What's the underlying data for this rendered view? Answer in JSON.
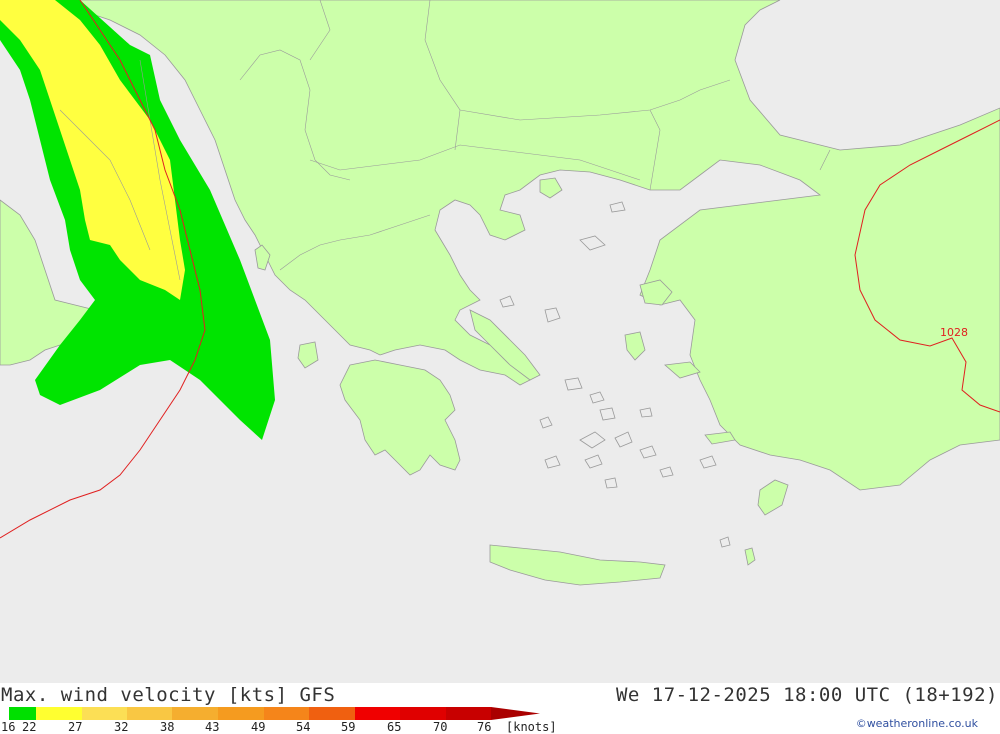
{
  "header": {
    "title": "Max. wind velocity [kts] GFS",
    "datetime": "We 17-12-2025 18:00 UTC (18+192)"
  },
  "map": {
    "isobar_label": "1028",
    "colors": {
      "sea": "#ececec",
      "land": "#ccffaa",
      "coast": "#9a9a9a",
      "isobar": "#e02020",
      "wind_16_22": "#00e400",
      "wind_22_27": "#ffff40"
    }
  },
  "legend": {
    "unit_label": "[knots]",
    "ticks": [
      "16",
      "22",
      "27",
      "32",
      "38",
      "43",
      "49",
      "54",
      "59",
      "65",
      "70",
      "76"
    ],
    "colors": [
      "#00e000",
      "#ffff30",
      "#fcdf55",
      "#f9c743",
      "#f5ae2f",
      "#f59b1f",
      "#f5851a",
      "#f06010",
      "#f00000",
      "#e00000",
      "#c80000",
      "#aa0000"
    ]
  },
  "credit": "©weatheronline.co.uk"
}
